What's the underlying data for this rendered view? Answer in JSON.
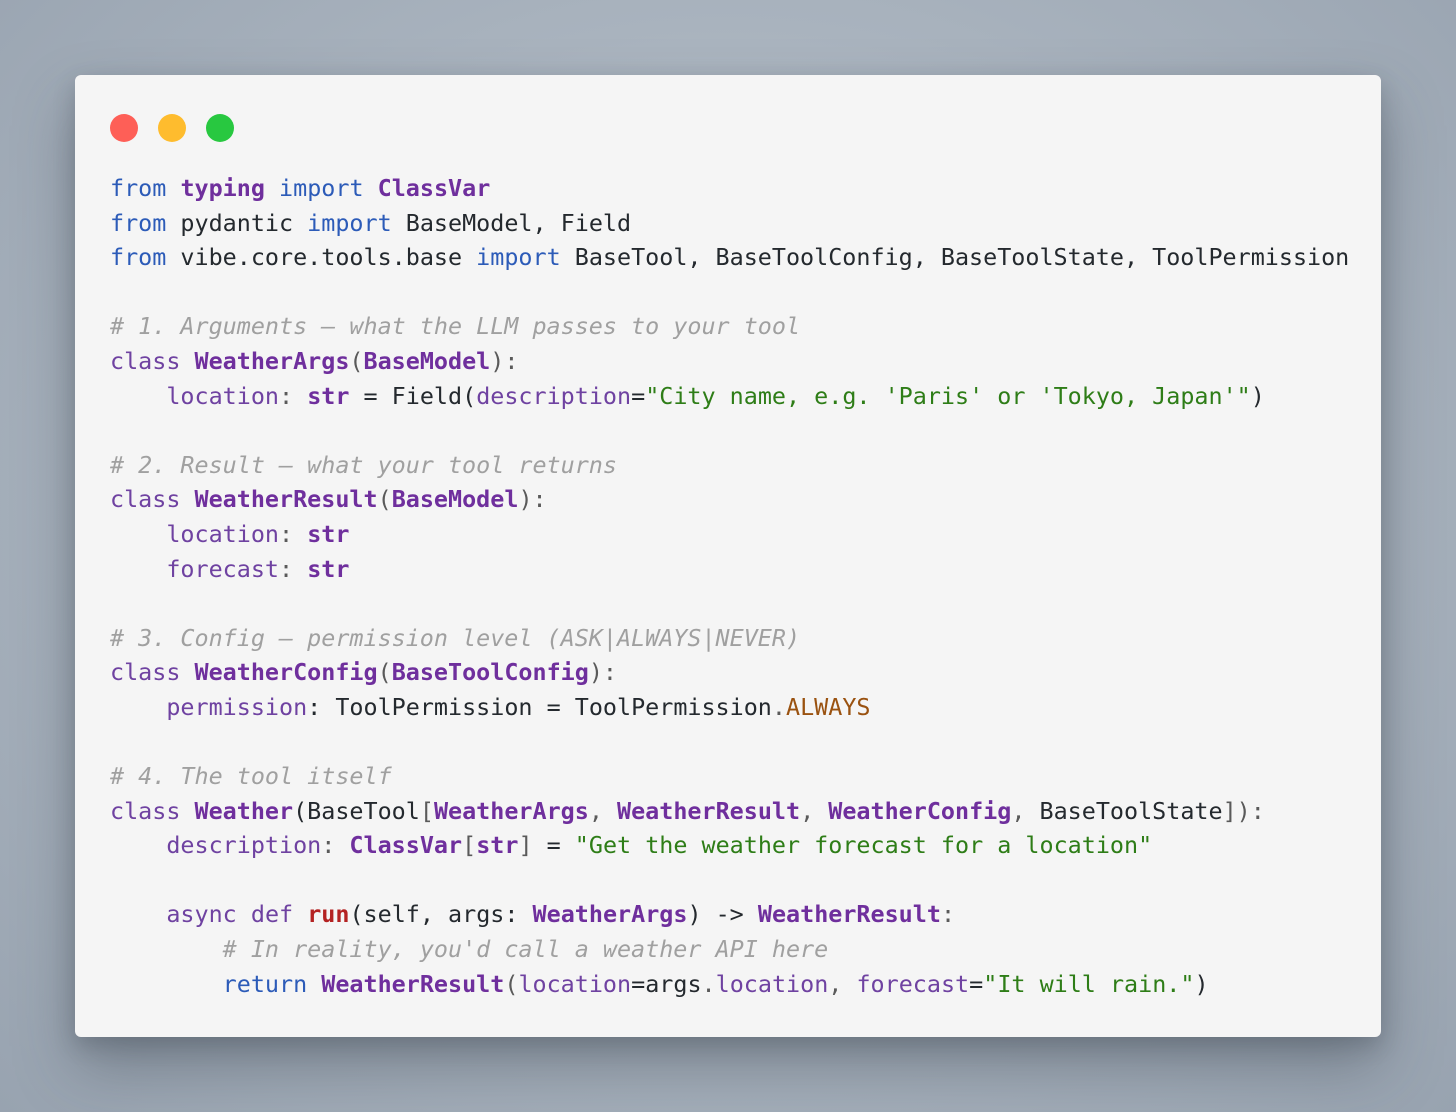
{
  "window": {
    "controls": {
      "close_color": "#fe5f57",
      "minimize_color": "#febc2e",
      "maximize_color": "#28c840"
    }
  },
  "code": {
    "language": "python",
    "imports": [
      {
        "t1": "from",
        "t2": " ",
        "t3": "typing",
        "t4": " ",
        "t5": "import",
        "t6": " ",
        "t7": "ClassVar"
      },
      {
        "t1": "from",
        "t2": " pydantic ",
        "t3": "import",
        "t4": " BaseModel, Field"
      },
      {
        "t1": "from",
        "t2": " vibe.core.tools.base ",
        "t3": "import",
        "t4": " BaseTool, BaseToolConfig, BaseToolState, ToolPermission"
      }
    ],
    "section1": {
      "comment": "# 1. Arguments – what the LLM passes to your tool",
      "class_kw": "class",
      "class_name": "WeatherArgs",
      "base": "BaseModel",
      "field_name": "location",
      "field_type": "str",
      "eq": " = Field(",
      "param": "description",
      "param_eq": "=",
      "value": "\"City name, e.g. 'Paris' or 'Tokyo, Japan'\"",
      "close": ")"
    },
    "section2": {
      "comment": "# 2. Result – what your tool returns",
      "class_kw": "class",
      "class_name": "WeatherResult",
      "base": "BaseModel",
      "fields": [
        {
          "name": "location",
          "type": "str"
        },
        {
          "name": "forecast",
          "type": "str"
        }
      ]
    },
    "section3": {
      "comment": "# 3. Config – permission level (ASK|ALWAYS|NEVER)",
      "class_kw": "class",
      "class_name": "WeatherConfig",
      "base": "BaseToolConfig",
      "field_name": "permission",
      "rest": ": ToolPermission = ToolPermission",
      "dot": ".",
      "const": "ALWAYS"
    },
    "section4": {
      "comment": "# 4. The tool itself",
      "class_kw": "class",
      "class_name": "Weather",
      "base_open": "(BaseTool",
      "generic_args": [
        "WeatherArgs",
        "WeatherResult",
        "WeatherConfig"
      ],
      "generic_tail": "BaseToolState",
      "close": "]):",
      "desc_name": "description",
      "desc_type": "ClassVar",
      "desc_inner": "str",
      "desc_value": "\"Get the weather forecast for a location\"",
      "async_kw": "async",
      "def_kw": "def",
      "fn_name": "run",
      "params": "(self, args: ",
      "arg_type": "WeatherArgs",
      "arrow": ") -> ",
      "ret_type": "WeatherResult",
      "inner_comment": "# In reality, you'd call a weather API here",
      "return_kw": "return",
      "return_class": "WeatherResult",
      "return_open": "(",
      "return_param1": "location",
      "return_val1": "=args",
      "return_dot": ".",
      "return_attr": "location",
      "return_sep": ", ",
      "return_param2": "forecast",
      "return_eq2": "=",
      "return_str": "\"It will rain.\"",
      "return_close": ")"
    }
  }
}
